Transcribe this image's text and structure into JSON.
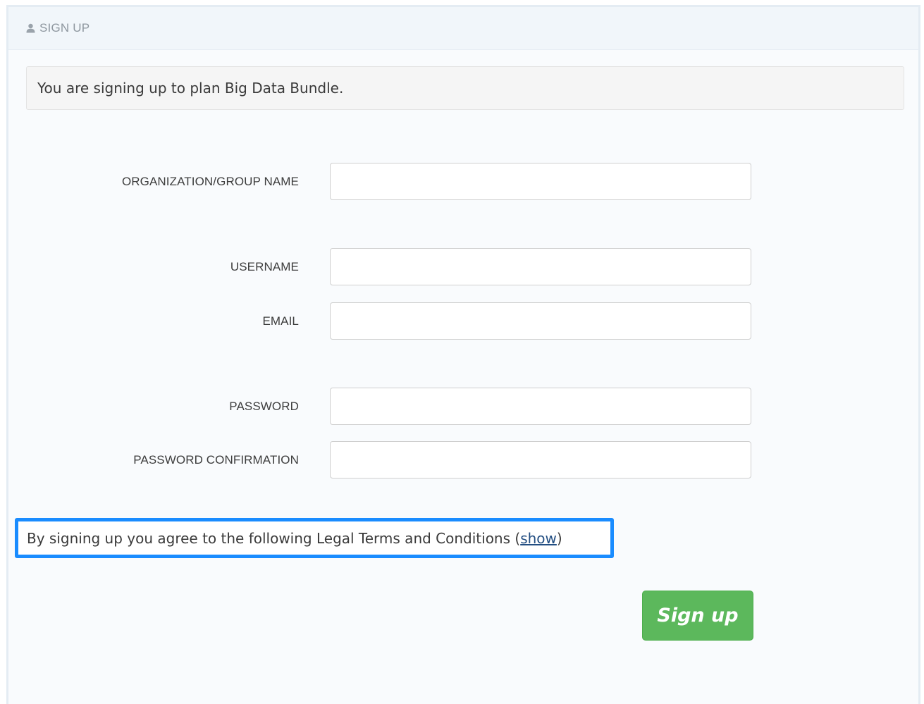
{
  "panel": {
    "title": "SIGN UP",
    "icon": "user-icon"
  },
  "notice": {
    "text": "You are signing up to plan Big Data Bundle."
  },
  "form": {
    "fields": [
      {
        "label": "ORGANIZATION/GROUP NAME",
        "value": "",
        "placeholder": ""
      },
      {
        "label": "USERNAME",
        "value": "",
        "placeholder": ""
      },
      {
        "label": "EMAIL",
        "value": "",
        "placeholder": ""
      },
      {
        "label": "PASSWORD",
        "value": "",
        "placeholder": ""
      },
      {
        "label": "PASSWORD CONFIRMATION",
        "value": "",
        "placeholder": ""
      }
    ]
  },
  "legal": {
    "prefix": "By signing up you agree to the following Legal Terms and Conditions (",
    "link": "show",
    "suffix": ")"
  },
  "actions": {
    "signup_label": "Sign up"
  },
  "colors": {
    "accent_highlight": "#1a8cff",
    "button_green": "#5cb85c",
    "link": "#234e82"
  }
}
